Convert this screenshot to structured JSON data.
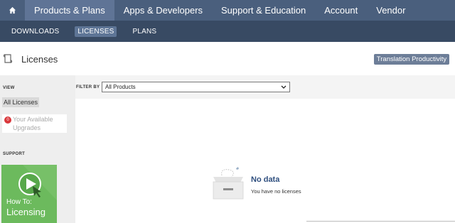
{
  "topnav": {
    "home_icon": "home-icon",
    "items": [
      {
        "label": "Products & Plans",
        "active": true
      },
      {
        "label": "Apps & Developers"
      },
      {
        "label": "Support & Education"
      },
      {
        "label": "Account"
      },
      {
        "label": "Vendor"
      }
    ]
  },
  "subnav": {
    "items": [
      {
        "label": "DOWNLOADS"
      },
      {
        "label": "LICENSES",
        "active": true
      },
      {
        "label": "PLANS"
      }
    ]
  },
  "page": {
    "title": "Licenses",
    "title_icon": "certificate-icon",
    "action_button": "Translation Productivity"
  },
  "sidebar": {
    "view_label": "VIEW",
    "all_licenses": "All Licenses",
    "upgrades_badge": "0",
    "upgrades_label": "Your Available Upgrades",
    "support_label": "SUPPORT",
    "howto_line1": "How To:",
    "howto_line2": "Licensing"
  },
  "filter": {
    "label": "FILTER BY",
    "selected": "All Products"
  },
  "empty_state": {
    "title": "No data",
    "subtitle": "You have no licenses"
  },
  "colors": {
    "topnav_bg": "#4a5f7d",
    "subnav_bg": "#384a63",
    "badge": "#d9373b",
    "howto_bg": "#6cba5d",
    "nodata_title": "#2e4e7e"
  }
}
